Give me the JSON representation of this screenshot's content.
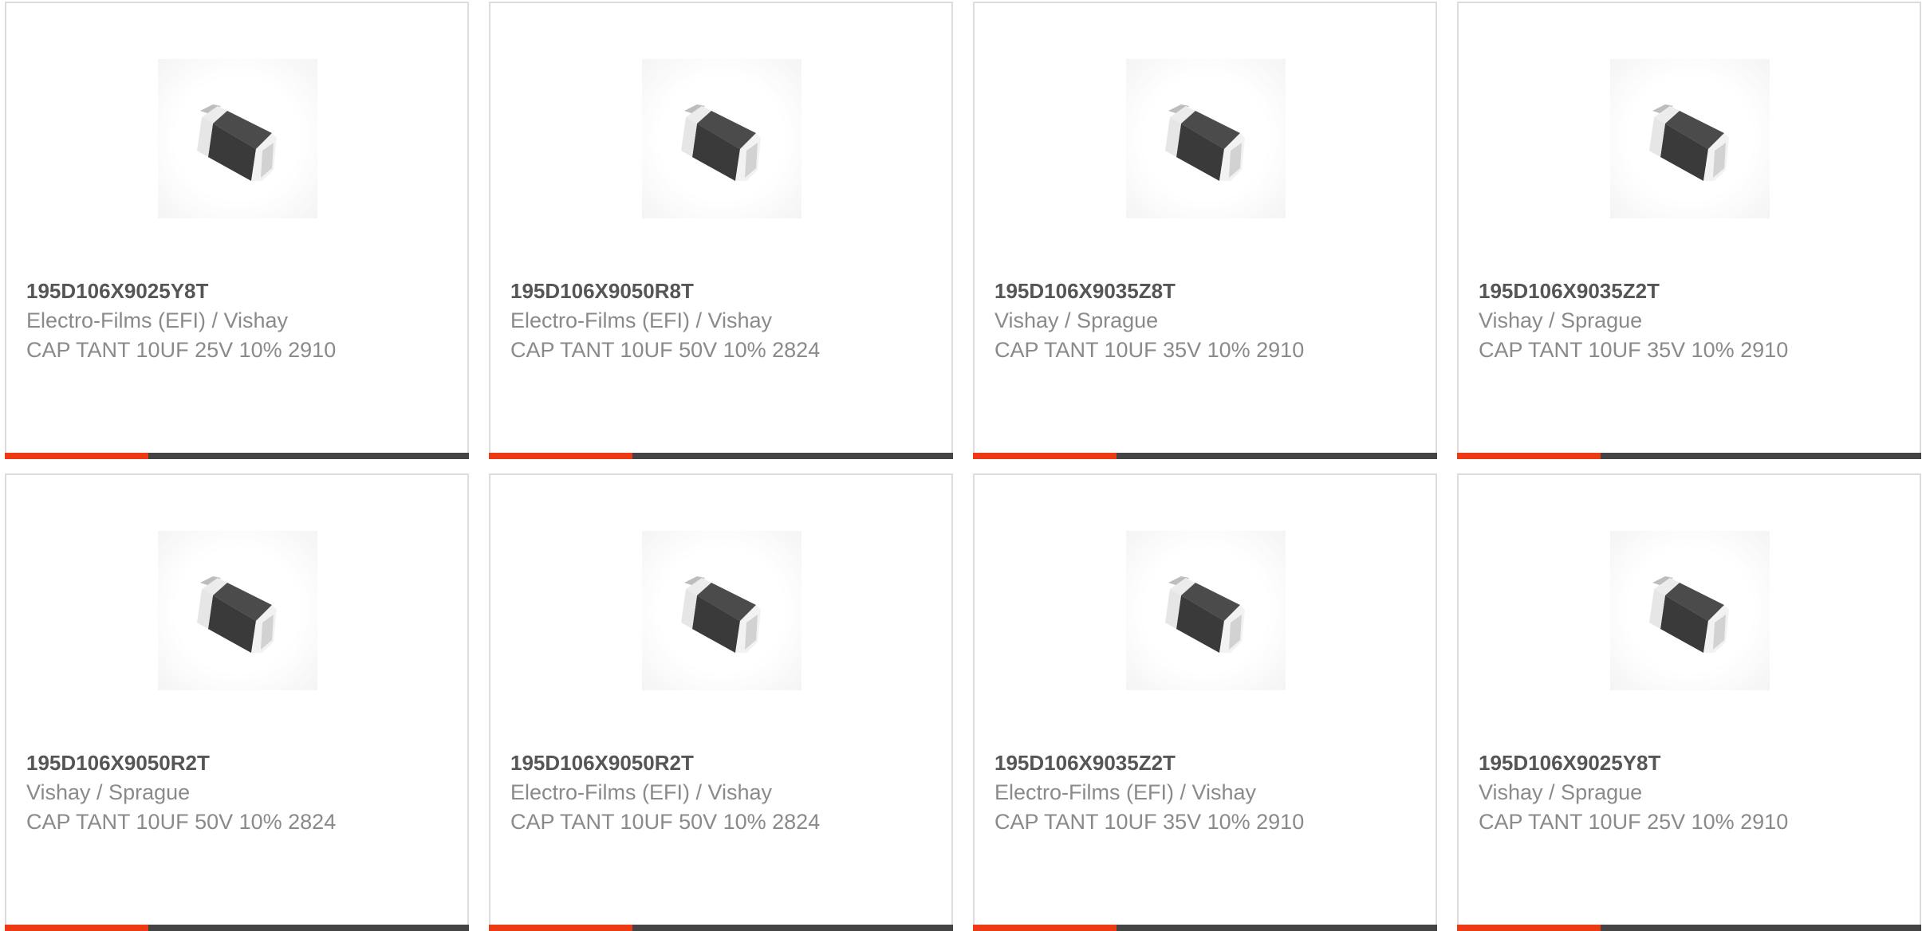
{
  "colors": {
    "accent": "#ee3a14",
    "bar": "#444444",
    "part_number": "#555555",
    "secondary_text": "#8a8a8a",
    "border": "#dcdcdc"
  },
  "products": [
    {
      "part_number": "195D106X9025Y8T",
      "manufacturer": "Electro-Films (EFI) / Vishay",
      "description": "CAP TANT 10UF 25V 10% 2910",
      "icon": "tantalum-capacitor-icon"
    },
    {
      "part_number": "195D106X9050R8T",
      "manufacturer": "Electro-Films (EFI) / Vishay",
      "description": "CAP TANT 10UF 50V 10% 2824",
      "icon": "tantalum-capacitor-icon"
    },
    {
      "part_number": "195D106X9035Z8T",
      "manufacturer": "Vishay / Sprague",
      "description": "CAP TANT 10UF 35V 10% 2910",
      "icon": "tantalum-capacitor-icon"
    },
    {
      "part_number": "195D106X9035Z2T",
      "manufacturer": "Vishay / Sprague",
      "description": "CAP TANT 10UF 35V 10% 2910",
      "icon": "tantalum-capacitor-icon"
    },
    {
      "part_number": "195D106X9050R2T",
      "manufacturer": "Vishay / Sprague",
      "description": "CAP TANT 10UF 50V 10% 2824",
      "icon": "tantalum-capacitor-icon"
    },
    {
      "part_number": "195D106X9050R2T",
      "manufacturer": "Electro-Films (EFI) / Vishay",
      "description": "CAP TANT 10UF 50V 10% 2824",
      "icon": "tantalum-capacitor-icon"
    },
    {
      "part_number": "195D106X9035Z2T",
      "manufacturer": "Electro-Films (EFI) / Vishay",
      "description": "CAP TANT 10UF 35V 10% 2910",
      "icon": "tantalum-capacitor-icon"
    },
    {
      "part_number": "195D106X9025Y8T",
      "manufacturer": "Vishay / Sprague",
      "description": "CAP TANT 10UF 25V 10% 2910",
      "icon": "tantalum-capacitor-icon"
    }
  ],
  "accent_bar_fraction": 0.31
}
